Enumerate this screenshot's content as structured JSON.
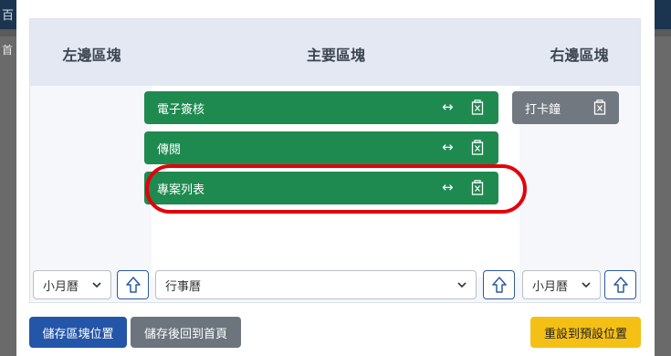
{
  "backdrop": {
    "topbar_char": "百",
    "side_char": "首"
  },
  "columns": {
    "left_title": "左邊區塊",
    "main_title": "主要區塊",
    "right_title": "右邊區塊"
  },
  "main_items": [
    {
      "label": "電子簽核"
    },
    {
      "label": "傳閱"
    },
    {
      "label": "專案列表"
    }
  ],
  "right_items": [
    {
      "label": "打卡鐘"
    }
  ],
  "selects": {
    "left_value": "小月曆",
    "main_value": "行事曆",
    "right_value": "小月曆"
  },
  "buttons": {
    "save_layout": "儲存區塊位置",
    "save_home": "儲存後回到首頁",
    "reset": "重設到預設位置"
  },
  "colors": {
    "item_green": "#1e8a4f",
    "item_gray": "#727880",
    "highlight_red": "#e4000b",
    "primary_blue": "#2356a8",
    "warning_yellow": "#f5c015"
  }
}
